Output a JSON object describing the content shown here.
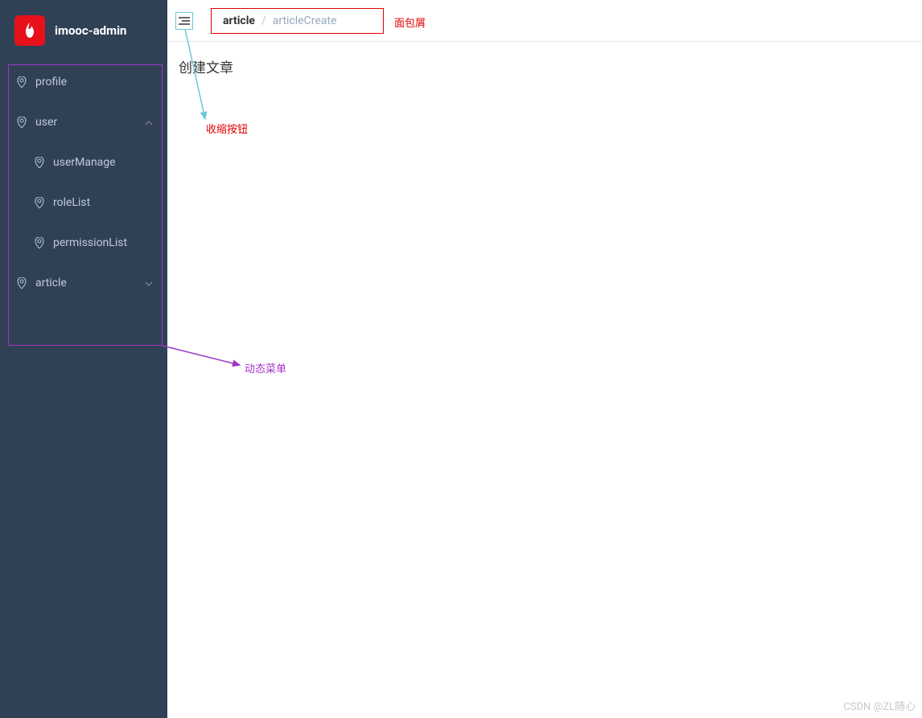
{
  "app": {
    "title": "imooc-admin"
  },
  "sidebar": {
    "items": [
      {
        "label": "profile",
        "has_children": false
      },
      {
        "label": "user",
        "has_children": true,
        "expanded": true,
        "arrow": "up",
        "children": [
          {
            "label": "userManage"
          },
          {
            "label": "roleList"
          },
          {
            "label": "permissionList"
          }
        ]
      },
      {
        "label": "article",
        "has_children": true,
        "expanded": false,
        "arrow": "down"
      }
    ]
  },
  "header": {
    "breadcrumb": {
      "root": "article",
      "separator": "/",
      "current": "articleCreate"
    }
  },
  "main": {
    "page_title": "创建文章"
  },
  "annotations": {
    "breadcrumb_label": "面包屑",
    "collapse_button_label": "收缩按钮",
    "dynamic_menu_label": "动态菜单"
  },
  "watermark": "CSDN @ZL随心"
}
